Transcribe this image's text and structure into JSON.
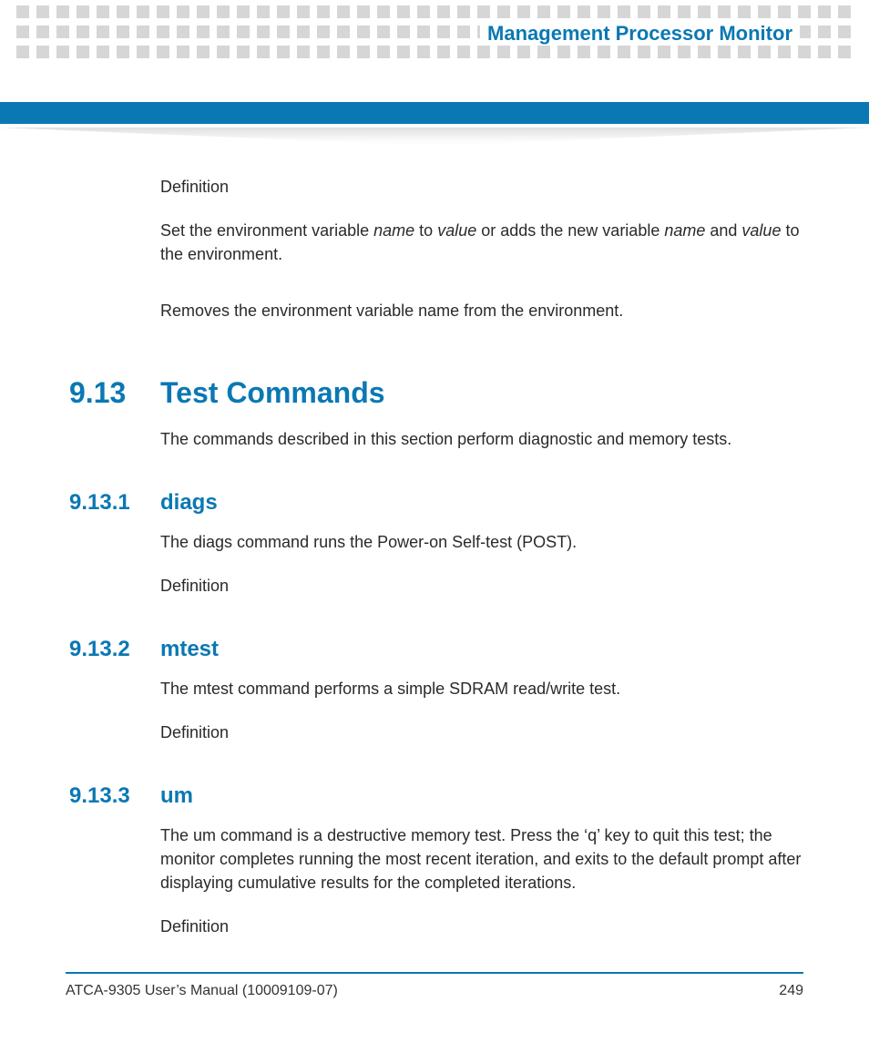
{
  "header": {
    "section_title": "Management Processor Monitor"
  },
  "body": {
    "definition_label1": "Definition",
    "para1_part1": "Set the environment variable ",
    "para1_name1": "name",
    "para1_part2": " to ",
    "para1_value1": "value",
    "para1_part3": " or adds the new variable ",
    "para1_name2": "name",
    "para1_part4": " and ",
    "para1_value2": "value",
    "para1_part5": " to the environment.",
    "para2": "Removes the environment variable name from the environment.",
    "h1_num": "9.13",
    "h1_title": "Test Commands",
    "h1_intro": "The commands described in this section perform diagnostic and memory tests.",
    "s1_num": "9.13.1",
    "s1_title": "diags",
    "s1_body": "The diags command runs the Power-on Self-test (POST).",
    "s1_def": "Definition",
    "s2_num": "9.13.2",
    "s2_title": "mtest",
    "s2_body": "The mtest command performs a simple SDRAM read/write test.",
    "s2_def": "Definition",
    "s3_num": "9.13.3",
    "s3_title": "um",
    "s3_body": "The um command is a destructive memory test. Press the ‘q’ key to quit this test; the monitor completes running the most recent iteration, and exits to the default prompt after displaying cumulative results for the completed iterations.",
    "s3_def": "Definition"
  },
  "footer": {
    "left": "ATCA-9305 User’s Manual (10009109-07)",
    "page": "249"
  }
}
